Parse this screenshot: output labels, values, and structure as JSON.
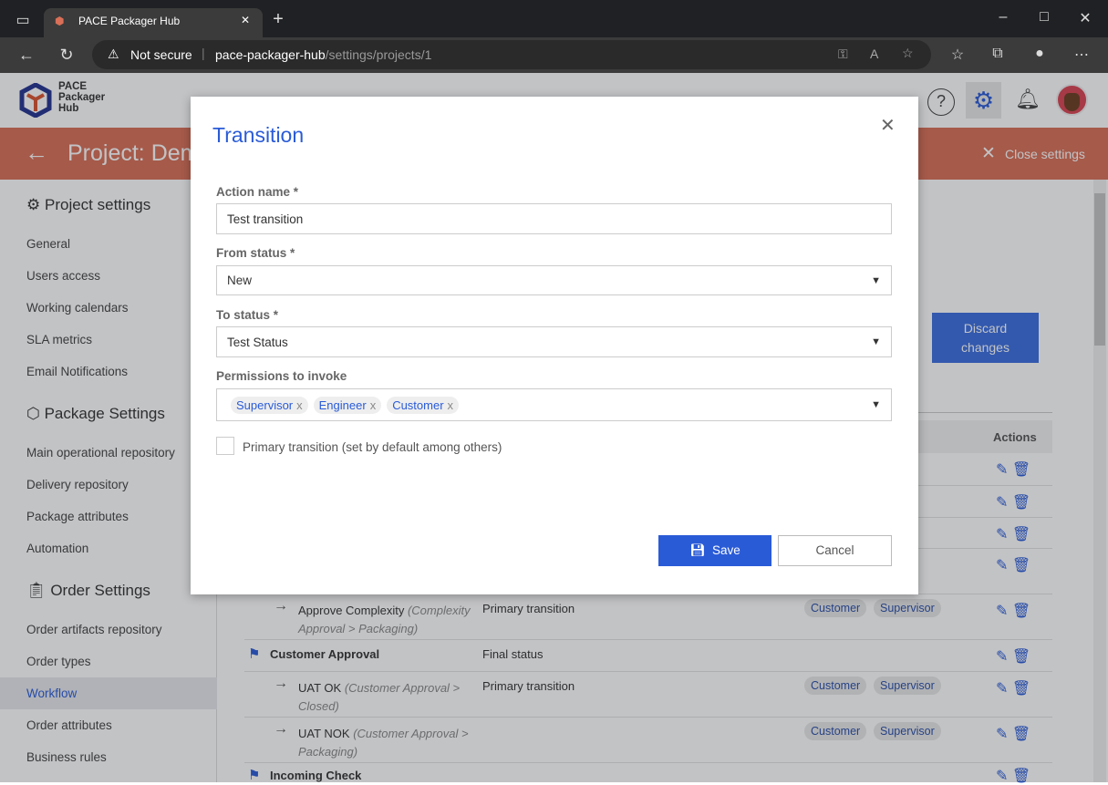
{
  "browser": {
    "tab_title": "PACE Packager Hub",
    "security": "Not secure",
    "url_host": "pace-packager-hub",
    "url_path": "/settings/projects/1"
  },
  "header": {
    "logo_text": [
      "PACE",
      "Packager",
      "Hub"
    ]
  },
  "redbar": {
    "title": "Project: Dem",
    "close": "Close settings"
  },
  "sidebar": {
    "project_heading": "Project settings",
    "project_items": [
      "General",
      "Users access",
      "Working calendars",
      "SLA metrics",
      "Email Notifications"
    ],
    "package_heading": "Package Settings",
    "package_items": [
      "Main operational repository",
      "Delivery repository",
      "Package attributes",
      "Automation"
    ],
    "order_heading": "Order Settings",
    "order_items": [
      "Order artifacts repository",
      "Order types",
      "Workflow",
      "Order attributes",
      "Business rules"
    ],
    "selected": "Workflow"
  },
  "main": {
    "discard": [
      "Discard",
      "changes"
    ],
    "actions_header": "Actions",
    "partial_chip": "sor",
    "rows": [
      {
        "name": "Approve Complexity",
        "sub1": "(Complexity",
        "sub2": "Approval > Packaging)",
        "desc": "Primary transition",
        "chips": [
          "Customer",
          "Supervisor"
        ]
      },
      {
        "name": "Customer Approval",
        "desc": "Final status"
      },
      {
        "name": "UAT OK",
        "sub1": "(Customer Approval >",
        "sub2": "Closed)",
        "desc": "Primary transition",
        "chips": [
          "Customer",
          "Supervisor"
        ]
      },
      {
        "name": "UAT NOK",
        "sub1": "(Customer Approval >",
        "sub2": "Packaging)",
        "chips": [
          "Customer",
          "Supervisor"
        ]
      },
      {
        "name": "Incoming Check"
      }
    ]
  },
  "modal": {
    "title": "Transition",
    "action_label": "Action name *",
    "action_value": "Test transition",
    "from_label": "From status *",
    "from_value": "New",
    "to_label": "To status *",
    "to_value": "Test Status",
    "perm_label": "Permissions to invoke",
    "permissions": [
      "Supervisor",
      "Engineer",
      "Customer"
    ],
    "primary_label": "Primary transition (set by default among others)",
    "primary_checked": false,
    "save": "Save",
    "cancel": "Cancel"
  },
  "colors": {
    "accent": "#2a5bd7",
    "banner": "#d96f57"
  }
}
